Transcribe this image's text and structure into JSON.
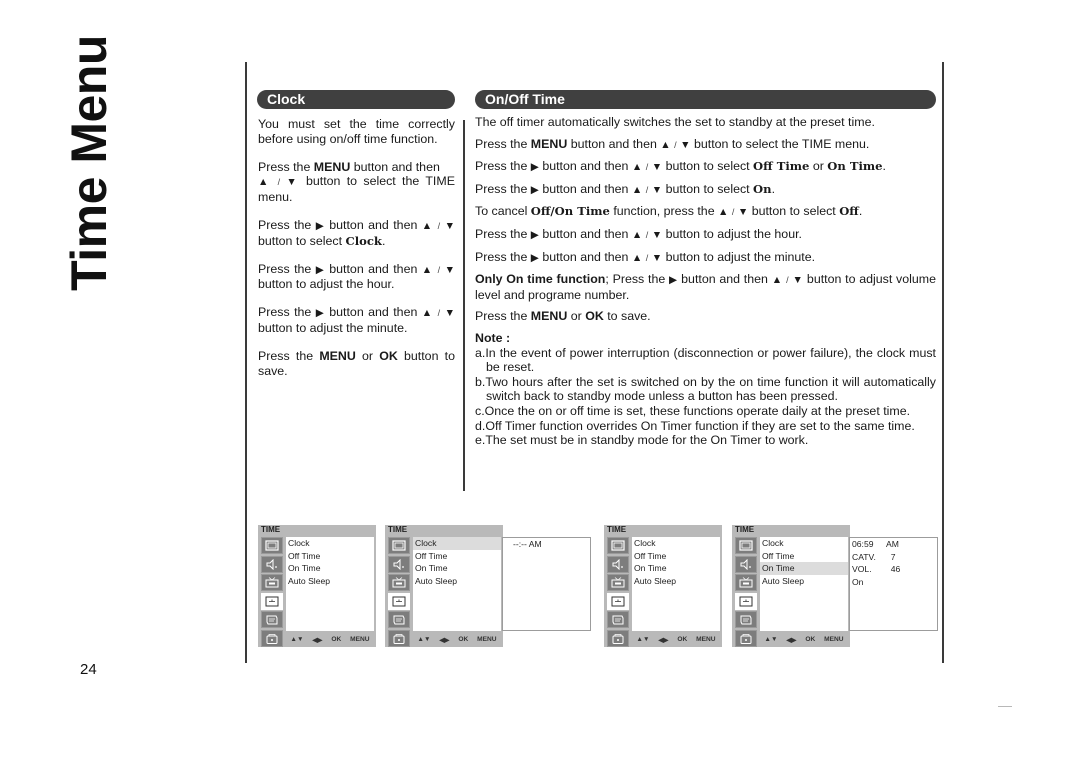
{
  "page": {
    "side_title": "Time Menu",
    "page_number": "24"
  },
  "clock_section": {
    "title": "Clock",
    "p1": "You must set the time correctly before using on/off time function.",
    "p2": {
      "pre": "Press the ",
      "bold": "MENU",
      "post": " button and then",
      "arrows_post": " button to select the TIME menu."
    },
    "p3": {
      "pre": "Press the ",
      "post": " button and then ",
      "tail": "button to select ",
      "target": "Clock",
      "end": "."
    },
    "p4": {
      "pre": "Press the ",
      "post": " button and then ",
      "tail": "button to adjust the hour."
    },
    "p5": {
      "pre": "Press the ",
      "post": " button and then ",
      "tail": "button to adjust the minute."
    },
    "p6": {
      "pre": "Press the ",
      "b1": "MENU",
      "mid": " or ",
      "b2": "OK",
      "post": " button to save."
    }
  },
  "onoff_section": {
    "title": "On/Off Time",
    "p1": "The off timer automatically switches the set to standby at the preset time.",
    "p2": {
      "pre": "Press the ",
      "bold": "MENU",
      "post": " button and then ",
      "tail": " button to select the TIME menu."
    },
    "p3": {
      "pre": "Press the ",
      "post": " button and then ",
      "tail": " button to select ",
      "t1": "Off Time",
      "mid": " or ",
      "t2": "On Time",
      "end": "."
    },
    "p4": {
      "pre": "Press the ",
      "post": " button and then ",
      "tail": " button to select ",
      "t1": "On",
      "end": "."
    },
    "p5": {
      "pre": "To cancel ",
      "t1": "Off/On Time",
      "post": " function, press the ",
      "tail": " button to select ",
      "t2": "Off",
      "end": "."
    },
    "p6": {
      "pre": "Press the ",
      "post": " button and then ",
      "tail": " button to adjust the hour."
    },
    "p7": {
      "pre": "Press the ",
      "post": " button and then ",
      "tail": " button to adjust the minute."
    },
    "p8": {
      "bold": "Only On time function",
      "pre": "; Press the ",
      "post": " button and then ",
      "tail": " button to adjust volume level and programe number."
    },
    "p9": {
      "pre": "Press the ",
      "b1": "MENU",
      "mid": " or ",
      "b2": "OK",
      "post": " to save."
    },
    "note_title": "Note :",
    "notes": [
      "a.In the event of power interruption (disconnection or power failure), the clock must be reset.",
      "b.Two hours after the set is switched on by the on time function it will automatically switch back to standby mode unless a button has been pressed.",
      "c.Once the on or off time is set, these functions operate daily at the preset time.",
      "d.Off Timer function overrides On Timer function if they are set to the same time.",
      "e.The set must be in standby mode for the On Timer to work."
    ]
  },
  "glyphs": {
    "right": "▶",
    "up": "▲",
    "down": "▼",
    "slash": "/"
  },
  "osd": {
    "header": "TIME",
    "items": [
      "Clock",
      "Off Time",
      "On Time",
      "Auto Sleep"
    ],
    "footer": [
      "▲▼",
      "◀▶",
      "OK",
      "MENU"
    ],
    "icons": [
      "picture-icon",
      "sound-icon",
      "station-icon",
      "time-icon",
      "special-icon",
      "lock-icon"
    ],
    "active_icon": "time-icon",
    "screens": [
      {
        "selected": null,
        "submenu": null
      },
      {
        "selected": "Clock",
        "submenu": [
          {
            "k": "--:-- AM",
            "v": ""
          }
        ]
      },
      {
        "selected": null,
        "submenu": null
      },
      {
        "selected": "On Time",
        "submenu": [
          {
            "k": "06:59",
            "v": "AM"
          },
          {
            "k": "CATV.",
            "v": "  7"
          },
          {
            "k": "VOL.",
            "v": "  46"
          },
          {
            "k": "On",
            "v": ""
          }
        ]
      }
    ]
  }
}
